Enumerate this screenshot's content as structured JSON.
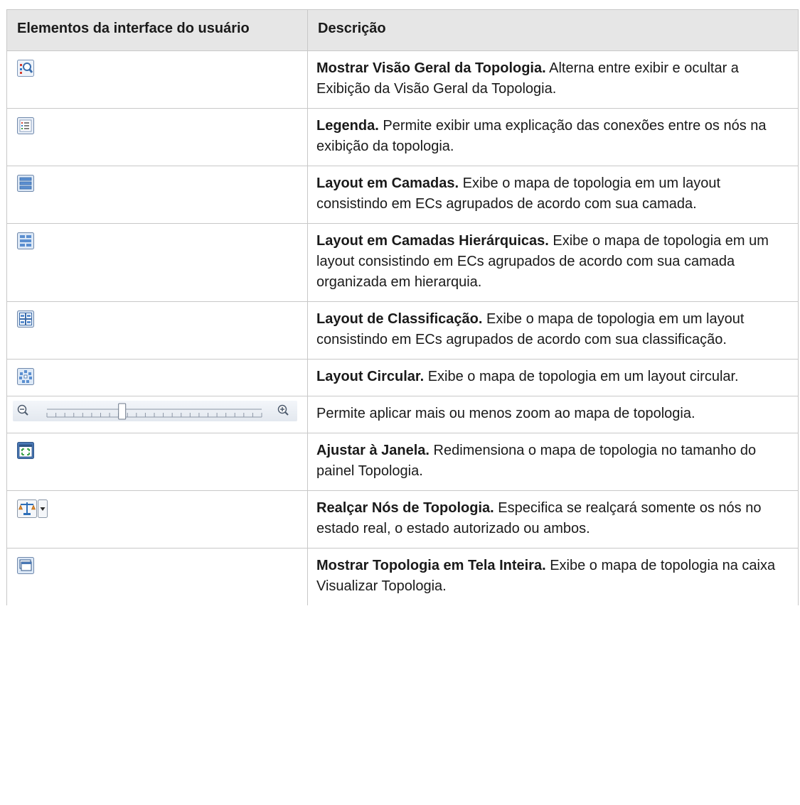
{
  "table": {
    "headers": [
      "Elementos da interface do usuário",
      "Descrição"
    ],
    "rows": [
      {
        "icon": "topology-overview-icon",
        "title": "Mostrar Visão Geral da Topologia.",
        "text": " Alterna entre exibir e ocultar a Exibição da Visão Geral da Topologia."
      },
      {
        "icon": "legend-icon",
        "title": "Legenda.",
        "text": " Permite exibir uma explicação das conexões entre os nós na exibição da topologia."
      },
      {
        "icon": "layered-layout-icon",
        "title": "Layout em Camadas.",
        "text": " Exibe o mapa de topologia em um layout consistindo em ECs agrupados de acordo com sua camada."
      },
      {
        "icon": "hierarchical-layers-layout-icon",
        "title": "Layout em Camadas Hierárquicas.",
        "text": " Exibe o mapa de topologia em um layout consistindo em ECs agrupados de acordo com sua camada organizada em hierarquia."
      },
      {
        "icon": "classification-layout-icon",
        "title": "Layout de Classificação.",
        "text": " Exibe o mapa de topologia em um layout consistindo em ECs agrupados de acordo com sua classificação."
      },
      {
        "icon": "circular-layout-icon",
        "title": "Layout Circular.",
        "text": " Exibe o mapa de topologia em um layout circular."
      },
      {
        "icon": "zoom-slider",
        "title": "",
        "text": "Permite aplicar mais ou menos zoom ao mapa de topologia."
      },
      {
        "icon": "fit-to-window-icon",
        "title": "Ajustar à Janela.",
        "text": " Redimensiona o mapa de topologia no tamanho do painel Topologia."
      },
      {
        "icon": "highlight-nodes-icon",
        "title": "Realçar Nós de Topologia.",
        "text": " Especifica se realçará somente os nós no estado real, o estado autorizado ou ambos."
      },
      {
        "icon": "fullscreen-topology-icon",
        "title": "Mostrar Topologia em Tela Inteira.",
        "text": " Exibe o mapa de topologia na caixa Visualizar Topologia."
      }
    ]
  },
  "zoom": {
    "level": 0.35
  }
}
